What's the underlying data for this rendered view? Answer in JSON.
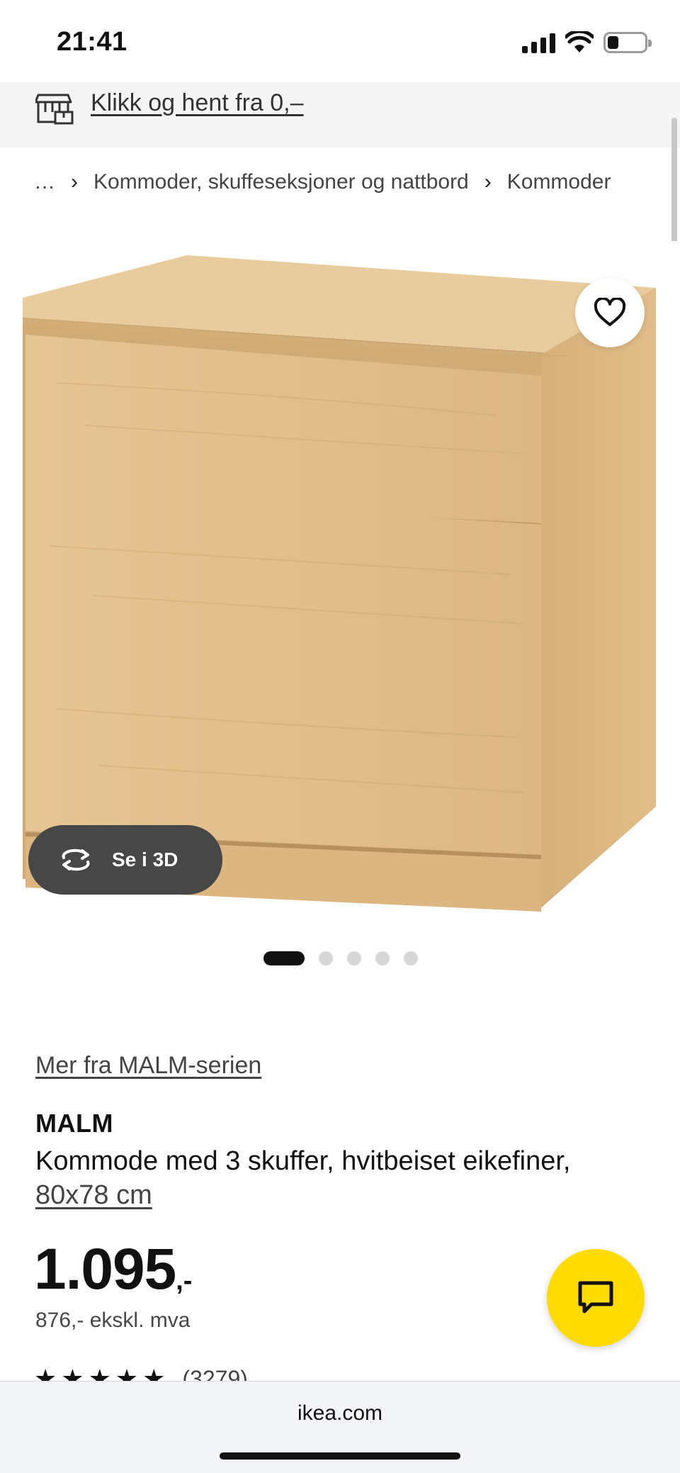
{
  "status_bar": {
    "time": "21:41",
    "battery_level": 0.3
  },
  "banner": {
    "pickup_text": "Klikk og hent fra 0,–"
  },
  "breadcrumb": {
    "ellipsis": "…",
    "items": [
      "Kommoder, skuffeseksjoner og nattbord",
      "Kommoder"
    ],
    "separator": "›"
  },
  "gallery": {
    "view_3d_label": "Se i 3D",
    "image_count": 5,
    "active_index": 0
  },
  "product": {
    "series_link": "Mer fra MALM-serien",
    "name": "MALM",
    "description": "Kommode med 3 skuffer, hvitbeiset eikefiner,",
    "size": "80x78 cm",
    "price_main": "1.095",
    "price_suffix": ",-",
    "price_ex_vat": "876,- ekskl. mva",
    "rating_count": "(3279)",
    "rating_value": 4.5
  },
  "browser": {
    "url": "ikea.com"
  },
  "colors": {
    "chat_button": "#ffdb00",
    "view_3d_button": "#474747",
    "banner_bg": "#f5f5f5",
    "wood_light": "#e8c99a",
    "wood_mid": "#ddb886",
    "wood_dark": "#c9a26c"
  },
  "icons": {
    "pickup": "store-pickup-icon",
    "favorite": "heart-icon",
    "view_3d": "rotate-3d-icon",
    "chat": "chat-bubble-icon"
  }
}
